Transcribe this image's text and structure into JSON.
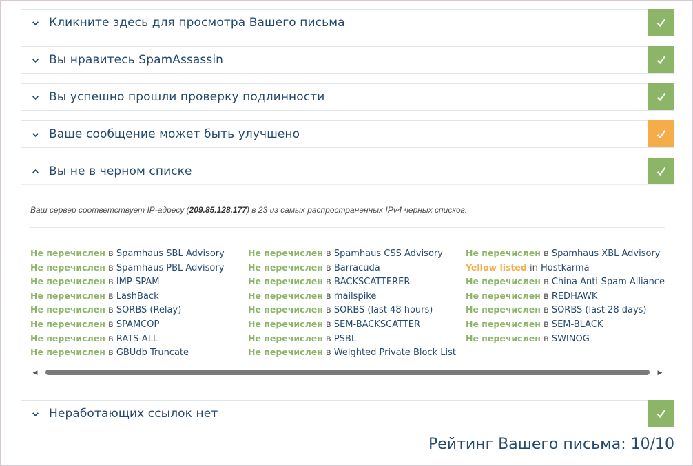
{
  "panels": [
    {
      "title": "Кликните здесь для просмотра Вашего письма",
      "status": "ok",
      "chevron": "chevron-down-icon"
    },
    {
      "title": "Вы нравитесь SpamAssassin",
      "status": "ok",
      "chevron": "chevron-down-icon"
    },
    {
      "title": "Вы успешно прошли проверку подлинности",
      "status": "ok",
      "chevron": "chevron-down-icon"
    },
    {
      "title": "Ваше сообщение может быть улучшено",
      "status": "warn",
      "chevron": "chevron-down-icon"
    },
    {
      "title": "Вы не в черном списке",
      "status": "ok",
      "chevron": "chevron-up-icon"
    },
    {
      "title": "Неработающих ссылок нет",
      "status": "ok",
      "chevron": "chevron-down-icon"
    }
  ],
  "blacklist": {
    "intro_prefix": "Ваш сервер соответствует IP-адресу (",
    "ip": "209.85.128.177",
    "intro_suffix": ") в 23 из самых распространенных IPv4 черных списков.",
    "in_word": "в",
    "columns": [
      [
        {
          "status": "Не перечислен",
          "name": "Spamhaus SBL Advisory",
          "color": "green"
        },
        {
          "status": "Не перечислен",
          "name": "Spamhaus PBL Advisory",
          "color": "green"
        },
        {
          "status": "Не перечислен",
          "name": "IMP-SPAM",
          "color": "green"
        },
        {
          "status": "Не перечислен",
          "name": "LashBack",
          "color": "green"
        },
        {
          "status": "Не перечислен",
          "name": "SORBS (Relay)",
          "color": "green"
        },
        {
          "status": "Не перечислен",
          "name": "SPAMCOP",
          "color": "green"
        },
        {
          "status": "Не перечислен",
          "name": "RATS-ALL",
          "color": "green"
        },
        {
          "status": "Не перечислен",
          "name": "GBUdb Truncate",
          "color": "green"
        }
      ],
      [
        {
          "status": "Не перечислен",
          "name": "Spamhaus CSS Advisory",
          "color": "green"
        },
        {
          "status": "Не перечислен",
          "name": "Barracuda",
          "color": "green"
        },
        {
          "status": "Не перечислен",
          "name": "BACKSCATTERER",
          "color": "green"
        },
        {
          "status": "Не перечислен",
          "name": "mailspike",
          "color": "green"
        },
        {
          "status": "Не перечислен",
          "name": "SORBS (last 48 hours)",
          "color": "green"
        },
        {
          "status": "Не перечислен",
          "name": "SEM-BACKSCATTER",
          "color": "green"
        },
        {
          "status": "Не перечислен",
          "name": "PSBL",
          "color": "green"
        },
        {
          "status": "Не перечислен",
          "name": "Weighted Private Block List",
          "color": "green"
        }
      ],
      [
        {
          "status": "Не перечислен",
          "name": "Spamhaus XBL Advisory",
          "color": "green"
        },
        {
          "status": "Yellow listed",
          "name": "Hostkarma",
          "color": "yellow",
          "in": "in"
        },
        {
          "status": "Не перечислен",
          "name": "China Anti-Spam Alliance",
          "color": "green"
        },
        {
          "status": "Не перечислен",
          "name": "REDHAWK",
          "color": "green"
        },
        {
          "status": "Не перечислен",
          "name": "SORBS (last 28 days)",
          "color": "green"
        },
        {
          "status": "Не перечислен",
          "name": "SEM-BLACK",
          "color": "green"
        },
        {
          "status": "Не перечислен",
          "name": "SWINOG",
          "color": "green"
        }
      ]
    ]
  },
  "score": "Рейтинг Вашего письма: 10/10",
  "colors": {
    "ok": "#8db567",
    "warn": "#f5ad4a",
    "text": "#264a6e"
  }
}
